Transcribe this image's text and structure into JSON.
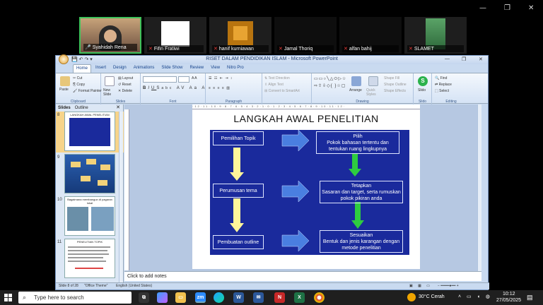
{
  "zoom": {
    "participants": [
      {
        "name": "Syahidah Rena",
        "active": true
      },
      {
        "name": "Fifin Fratiwi"
      },
      {
        "name": "hanif kurniawan"
      },
      {
        "name": "Jamal Thoriq"
      },
      {
        "name": "alfan bahij"
      },
      {
        "name": "SLAMET"
      }
    ]
  },
  "ppt": {
    "title": "RISET DALAM PENDIDIKAN ISLAM - Microsoft PowerPoint",
    "tabs": [
      "Home",
      "Insert",
      "Design",
      "Animations",
      "Slide Show",
      "Review",
      "View",
      "Nitro Pro"
    ],
    "ribbon": {
      "paste": "Paste",
      "cut": "Cut",
      "copy": "Copy",
      "format_painter": "Format Painter",
      "new_slide": "New Slide",
      "layout": "Layout",
      "reset": "Reset",
      "delete": "Delete",
      "text_direction": "Text Direction",
      "align_text": "Align Text",
      "convert_smartart": "Convert to SmartArt",
      "arrange": "Arrange",
      "quick_styles": "Quick Styles",
      "shape_fill": "Shape Fill",
      "shape_outline": "Shape Outline",
      "shape_effects": "Shape Effects",
      "slido": "Slido",
      "find": "Find",
      "replace": "Replace",
      "select": "Select",
      "groups": {
        "clipboard": "Clipboard",
        "slides": "Slides",
        "font": "Font",
        "paragraph": "Paragraph",
        "drawing": "Drawing",
        "slido": "Slido",
        "editing": "Editing"
      }
    },
    "panel_tabs": {
      "slides": "Slides",
      "outline": "Outline"
    },
    "thumbnails": [
      {
        "num": "8",
        "caption": "LANGKAH AWAL PENELITIAN"
      },
      {
        "num": "9",
        "caption": ""
      },
      {
        "num": "10",
        "caption": "Bagaimana membangun di pagaran lokal"
      },
      {
        "num": "11",
        "caption": "PENELITIAN TOPIK"
      }
    ],
    "slide": {
      "title": "LANGKAH AWAL PENELITIAN",
      "left_boxes": [
        "Pemilihan Topik",
        "Perumusan tema",
        "Pembuatan outline"
      ],
      "right_boxes": [
        {
          "head": "Pilih",
          "body": "Pokok bahasan tertentu dan tentukan ruang lingkupnya"
        },
        {
          "head": "Tetapkan",
          "body": "Sasaran dan target, serta rumuskan pokok pikiran anda"
        },
        {
          "head": "Sesuaikan",
          "body": "Bentuk dan jenis karangan dengan metode penelitian"
        }
      ]
    },
    "notes_placeholder": "Click to add notes",
    "status": {
      "slide_info": "Slide 8 of 28",
      "theme": "\"Office Theme\"",
      "language": "English (United States)",
      "zoom": "..."
    }
  },
  "taskbar": {
    "search_placeholder": "Type here to search",
    "weather": "30°C  Cerah",
    "time": "10:12",
    "date": "27/05/2025"
  },
  "colors": {
    "diagram_bg": "#1a2a9c",
    "arrow_blue": "#4a7fe0",
    "arrow_yellow": "#fff59a",
    "arrow_green": "#2ecc40"
  }
}
